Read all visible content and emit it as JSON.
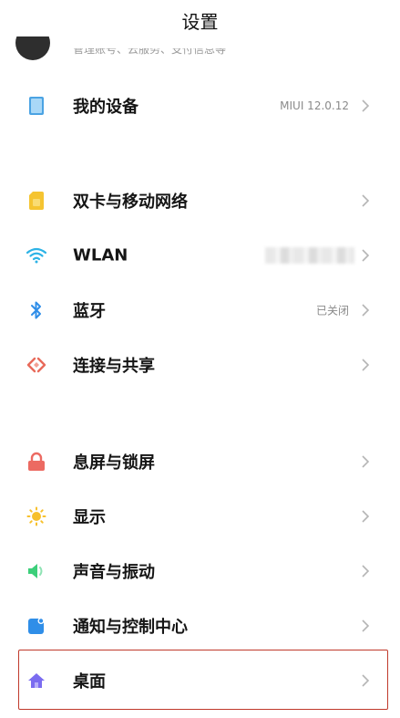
{
  "header": {
    "title": "设置"
  },
  "account": {
    "subtitle": "管理账号、云服务、支付信息等"
  },
  "sections": [
    {
      "items": [
        {
          "id": "my-device",
          "label": "我的设备",
          "value": "MIUI 12.0.12",
          "icon": "device-icon"
        }
      ]
    },
    {
      "items": [
        {
          "id": "dual-sim",
          "label": "双卡与移动网络",
          "value": "",
          "icon": "sim-card-icon"
        },
        {
          "id": "wlan",
          "label": "WLAN",
          "value": "",
          "icon": "wifi-icon"
        },
        {
          "id": "bluetooth",
          "label": "蓝牙",
          "value": "已关闭",
          "icon": "bluetooth-icon"
        },
        {
          "id": "connection-sharing",
          "label": "连接与共享",
          "value": "",
          "icon": "share-connection-icon"
        }
      ]
    },
    {
      "items": [
        {
          "id": "lock-screen",
          "label": "息屏与锁屏",
          "value": "",
          "icon": "lock-icon"
        },
        {
          "id": "display",
          "label": "显示",
          "value": "",
          "icon": "sun-icon"
        },
        {
          "id": "sound",
          "label": "声音与振动",
          "value": "",
          "icon": "speaker-icon"
        },
        {
          "id": "notifications",
          "label": "通知与控制中心",
          "value": "",
          "icon": "notification-icon"
        },
        {
          "id": "home-screen",
          "label": "桌面",
          "value": "",
          "icon": "home-icon"
        }
      ]
    }
  ],
  "colors": {
    "device": "#4ba3e3",
    "sim": "#f5c431",
    "wifi": "#2db3e6",
    "bluetooth": "#2f8ee8",
    "share": "#e86a5a",
    "lock": "#ec6a62",
    "sun": "#f7c02b",
    "speaker": "#3ccf7a",
    "notification": "#2f8ee8",
    "home": "#7b6cf0",
    "highlight": "#c0392b"
  }
}
